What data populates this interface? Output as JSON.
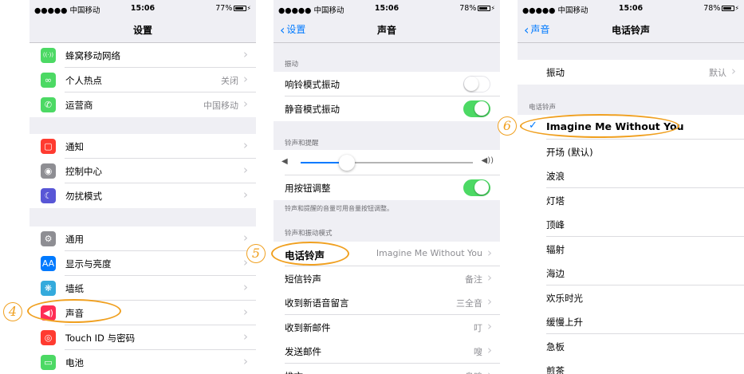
{
  "status": {
    "carrier": "●●●●● 中国移动",
    "wifi": "wifi",
    "time": "15:06",
    "phone1_battery": "77%",
    "phone2_battery": "78%",
    "phone3_battery": "78%"
  },
  "phone1": {
    "title": "设置",
    "group1": [
      {
        "label": "蜂窝移动网络",
        "value": "",
        "icon": "cellular-icon",
        "color": "#4cd964",
        "glyph": "((·))"
      },
      {
        "label": "个人热点",
        "value": "关闭",
        "icon": "hotspot-icon",
        "color": "#4cd964",
        "glyph": "∞"
      },
      {
        "label": "运营商",
        "value": "中国移动",
        "icon": "phone-icon",
        "color": "#4cd964",
        "glyph": "✆"
      }
    ],
    "group2": [
      {
        "label": "通知",
        "value": "",
        "icon": "notifications-icon",
        "color": "#ff3b30",
        "glyph": "▢"
      },
      {
        "label": "控制中心",
        "value": "",
        "icon": "control-center-icon",
        "color": "#8e8e93",
        "glyph": "◉"
      },
      {
        "label": "勿扰模式",
        "value": "",
        "icon": "moon-icon",
        "color": "#5856d6",
        "glyph": "☾"
      }
    ],
    "group3": [
      {
        "label": "通用",
        "value": "",
        "icon": "gear-icon",
        "color": "#8e8e93",
        "glyph": "⚙"
      },
      {
        "label": "显示与亮度",
        "value": "",
        "icon": "display-icon",
        "color": "#007aff",
        "glyph": "AA"
      },
      {
        "label": "墙纸",
        "value": "",
        "icon": "wallpaper-icon",
        "color": "#34aadc",
        "glyph": "❋"
      },
      {
        "label": "声音",
        "value": "",
        "icon": "speaker-icon",
        "color": "#ff2d55",
        "glyph": "◀)"
      },
      {
        "label": "Touch ID 与密码",
        "value": "",
        "icon": "fingerprint-icon",
        "color": "#ff3b30",
        "glyph": "◎"
      },
      {
        "label": "电池",
        "value": "",
        "icon": "battery-icon",
        "color": "#4cd964",
        "glyph": "▭"
      }
    ],
    "step_number": "4"
  },
  "phone2": {
    "back_label": "设置",
    "title": "声音",
    "vibrate_header": "振动",
    "vibrate_ring_label": "响铃模式振动",
    "vibrate_ring_on": false,
    "vibrate_silent_label": "静音模式振动",
    "vibrate_silent_on": true,
    "ringer_header": "铃声和提醒",
    "volume_level": 0.27,
    "change_with_buttons_label": "用按钮调整",
    "change_with_buttons_on": true,
    "ringer_footnote": "铃声和提醒的音量可用音量按钮调整。",
    "patterns_header": "铃声和振动模式",
    "patterns": [
      {
        "label": "电话铃声",
        "value": "Imagine Me Without You"
      },
      {
        "label": "短信铃声",
        "value": "备注"
      },
      {
        "label": "收到新语音留言",
        "value": "三全音"
      },
      {
        "label": "收到新邮件",
        "value": "叮"
      },
      {
        "label": "发送邮件",
        "value": "嗖"
      },
      {
        "label": "推文",
        "value": "鸟鸣"
      }
    ],
    "step_number": "5"
  },
  "phone3": {
    "back_label": "声音",
    "title": "电话铃声",
    "vibration_label": "振动",
    "vibration_value": "默认",
    "ringtones_header": "电话铃声",
    "ringtones": [
      "Imagine Me Without You",
      "开场 (默认)",
      "波浪",
      "灯塔",
      "顶峰",
      "辐射",
      "海边",
      "欢乐时光",
      "缓慢上升",
      "急板",
      "煎茶"
    ],
    "selected_index": 0,
    "step_number": "6"
  },
  "colors": {
    "accent": "#007aff",
    "highlight": "#f0a020",
    "toggle_on": "#4cd964"
  }
}
